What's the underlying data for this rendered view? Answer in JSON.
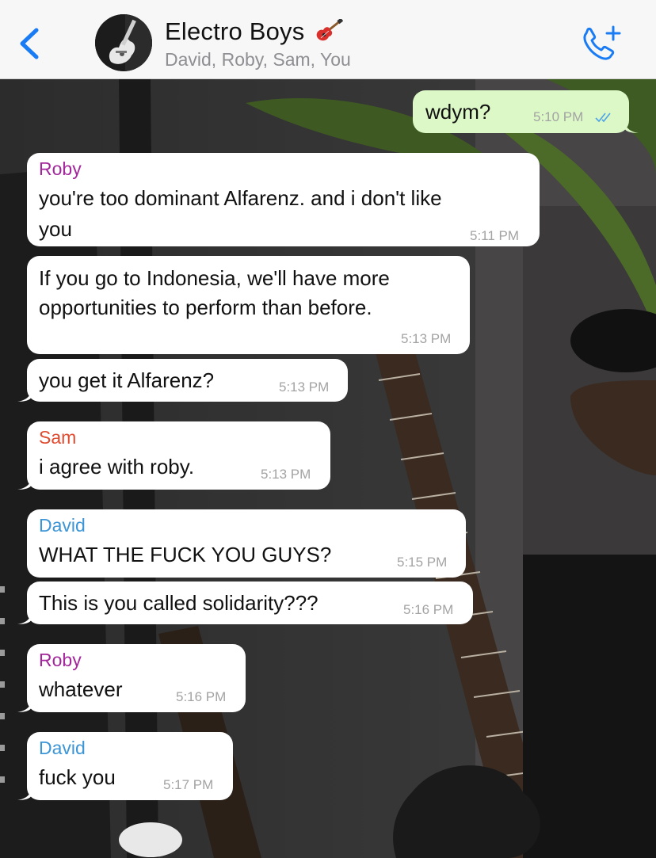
{
  "header": {
    "back_icon": "chevron-left-icon",
    "title": "Electro Boys",
    "title_emoji": "guitar-emoji",
    "subtitle": "David, Roby, Sam, You",
    "call_icon": "phone-plus-icon",
    "accent_color": "#1a7cf5"
  },
  "messages": [
    {
      "direction": "outgoing",
      "sender": "",
      "text": "wdym?",
      "time": "5:10 PM",
      "status": "read-double-check"
    },
    {
      "direction": "incoming",
      "sender": "Roby",
      "sender_color": "#a3279b",
      "text_line1": "you're too dominant Alfarenz. and i don't like",
      "text_line2": "you",
      "time": "5:11 PM"
    },
    {
      "direction": "incoming",
      "sender": "",
      "text_line1": "If you go to Indonesia, we'll have more",
      "text_line2": "opportunities to perform than before.",
      "time": "5:13 PM"
    },
    {
      "direction": "incoming",
      "sender": "",
      "text": "you get it Alfarenz?",
      "time": "5:13 PM"
    },
    {
      "direction": "incoming",
      "sender": "Sam",
      "sender_color": "#e04a2f",
      "text": "i agree with roby.",
      "time": "5:13 PM"
    },
    {
      "direction": "incoming",
      "sender": "David",
      "sender_color": "#3b95d6",
      "text": "WHAT THE FUCK YOU GUYS?",
      "time": "5:15 PM"
    },
    {
      "direction": "incoming",
      "sender": "",
      "text": "This is you called solidarity???",
      "time": "5:16 PM"
    },
    {
      "direction": "incoming",
      "sender": "Roby",
      "sender_color": "#a3279b",
      "text": "whatever",
      "time": "5:16 PM"
    },
    {
      "direction": "incoming",
      "sender": "David",
      "sender_color": "#3b95d6",
      "text": "fuck you",
      "time": "5:17 PM"
    }
  ],
  "colors": {
    "incoming_bubble": "#ffffff",
    "outgoing_bubble": "#dcf8c6",
    "timestamp": "#a3a3a3",
    "read_ticks": "#4fa3e8"
  }
}
